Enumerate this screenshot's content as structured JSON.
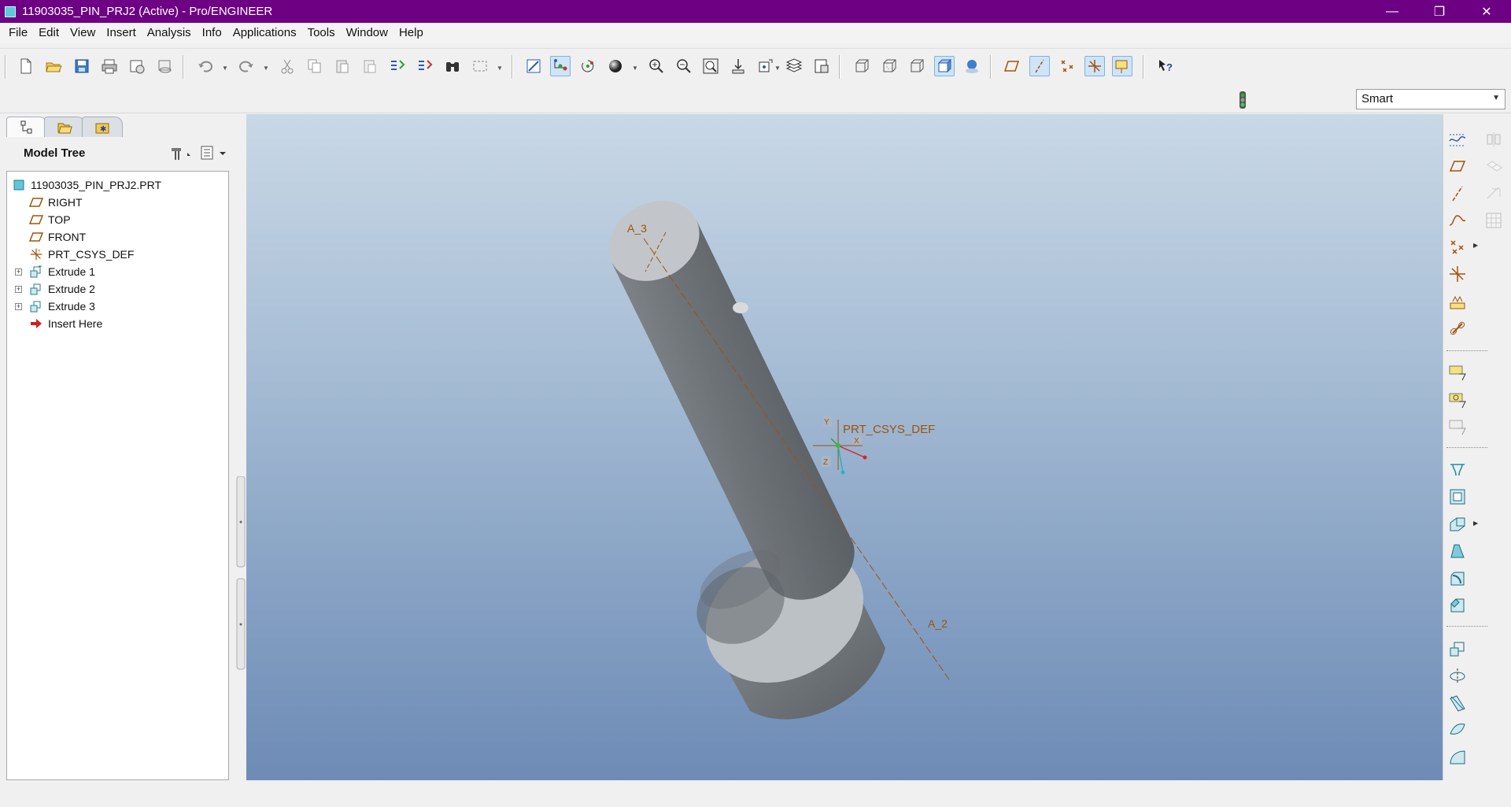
{
  "window": {
    "title": "11903035_PIN_PRJ2 (Active) - Pro/ENGINEER",
    "minimize_glyph": "—",
    "restore_glyph": "❐",
    "close_glyph": "✕"
  },
  "menu": [
    "File",
    "Edit",
    "View",
    "Insert",
    "Analysis",
    "Info",
    "Applications",
    "Tools",
    "Window",
    "Help"
  ],
  "filter": {
    "value": "Smart"
  },
  "model_tree": {
    "title": "Model Tree",
    "items": [
      {
        "label": "11903035_PIN_PRJ2.PRT",
        "icon": "part-icon"
      },
      {
        "label": "RIGHT",
        "icon": "datum-plane-icon"
      },
      {
        "label": "TOP",
        "icon": "datum-plane-icon"
      },
      {
        "label": "FRONT",
        "icon": "datum-plane-icon"
      },
      {
        "label": "PRT_CSYS_DEF",
        "icon": "csys-icon"
      },
      {
        "label": "Extrude 1",
        "icon": "extrude-icon"
      },
      {
        "label": "Extrude 2",
        "icon": "extrude-icon"
      },
      {
        "label": "Extrude 3",
        "icon": "extrude-icon"
      },
      {
        "label": "Insert Here",
        "icon": "insert-arrow-icon"
      }
    ]
  },
  "graphics": {
    "axis_top": "A_3",
    "axis_bottom": "A_2",
    "csys_label": "PRT_CSYS_DEF",
    "csys_x": "X",
    "csys_y": "Y",
    "csys_z": "Z"
  },
  "colors": {
    "titlebar": "#6d0083",
    "datum": "#a0520c",
    "background_top": "#c9d8e6",
    "background_bottom": "#6d8bb6"
  }
}
